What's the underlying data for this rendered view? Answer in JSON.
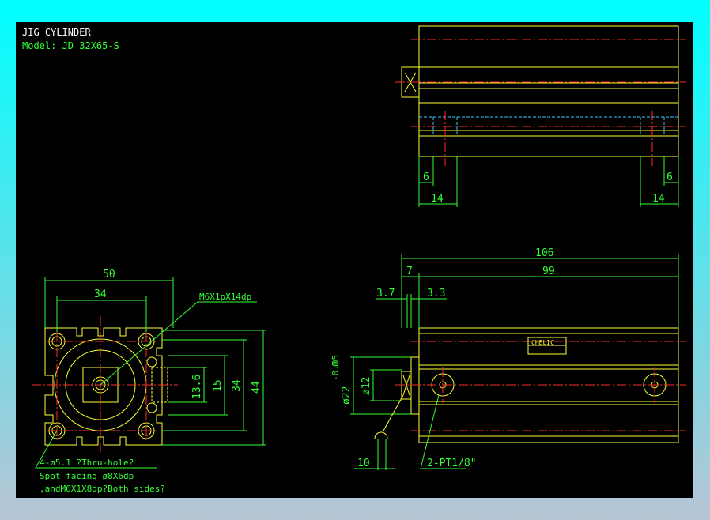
{
  "title": "JIG CYLINDER",
  "model": "Model: JD 32X65-S",
  "colors": {
    "background": "#000000",
    "outline": "#ffff33",
    "dimension": "#33ff33",
    "centerline": "#ff2a2a",
    "hidden": "#33ccff"
  },
  "front_view": {
    "dims": {
      "width_outer": "50",
      "hole_pitch_h": "34",
      "d13_6": "13.6",
      "d15": "15",
      "hole_pitch_v": "34",
      "height_outer": "44"
    },
    "thread_callout": "M6X1pX14dp",
    "note_lines": [
      "4-ø5.1 ?Thru-hole?",
      "Spot facing ø8X6dp",
      ",andM6X1X8dp?Both sides?"
    ]
  },
  "top_view": {
    "dims": {
      "left_6": "6",
      "left_14": "14",
      "right_6": "6",
      "right_14": "14"
    }
  },
  "side_view": {
    "dims": {
      "overall": "106",
      "body": "99",
      "rod": "7",
      "d3_7": "3.7",
      "d3_3": "3.3",
      "rod_dia": "ø12",
      "boss_dia": "ø22",
      "boss_tol_upper": "0",
      "boss_tol_lower": "-0.05",
      "wrench": "10"
    },
    "port_callout": "2-PT1/8\"",
    "label_brand": "CHELIC"
  }
}
